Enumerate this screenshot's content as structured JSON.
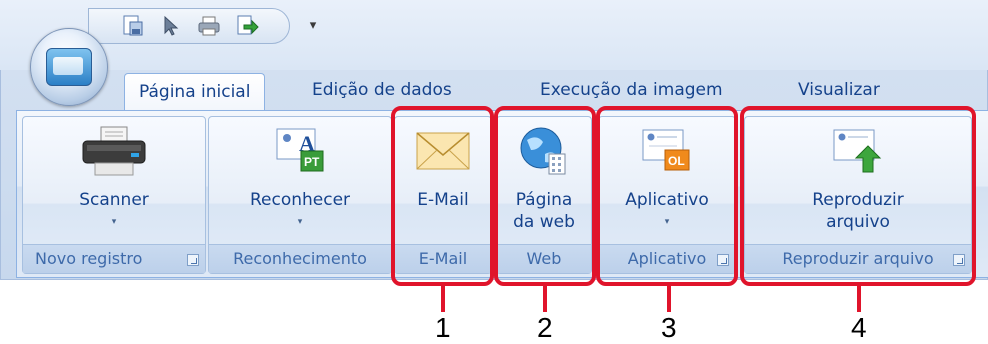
{
  "window": {
    "tabs": [
      {
        "label": "Página inicial",
        "active": true
      },
      {
        "label": "Edição de dados",
        "active": false
      },
      {
        "label": "Execução da imagem",
        "active": false
      },
      {
        "label": "Visualizar",
        "active": false
      }
    ],
    "quick_access_dropdown": "▾"
  },
  "groups": {
    "novo_registro": {
      "title": "Novo registro",
      "button": "Scanner",
      "dropdown": "▾"
    },
    "reconhecimento": {
      "title": "Reconhecimento",
      "button": "Reconhecer",
      "dropdown": "▾"
    },
    "email": {
      "title": "E-Mail",
      "button": "E-Mail"
    },
    "web": {
      "title": "Web",
      "button_line1": "Página",
      "button_line2": "da web"
    },
    "aplicativo": {
      "title": "Aplicativo",
      "button": "Aplicativo",
      "dropdown": "▾"
    },
    "reproduzir": {
      "title": "Reproduzir arquivo",
      "button_line1": "Reproduzir",
      "button_line2": "arquivo"
    }
  },
  "icons": {
    "aplicativo_badge": "OL",
    "reconhecer_badge": "PT",
    "reconhecer_letter": "A"
  },
  "callouts": [
    "1",
    "2",
    "3",
    "4"
  ],
  "colors": {
    "callout": "#e0142b",
    "ribbon_text": "#15428b",
    "group_title": "#3e6aaa"
  }
}
